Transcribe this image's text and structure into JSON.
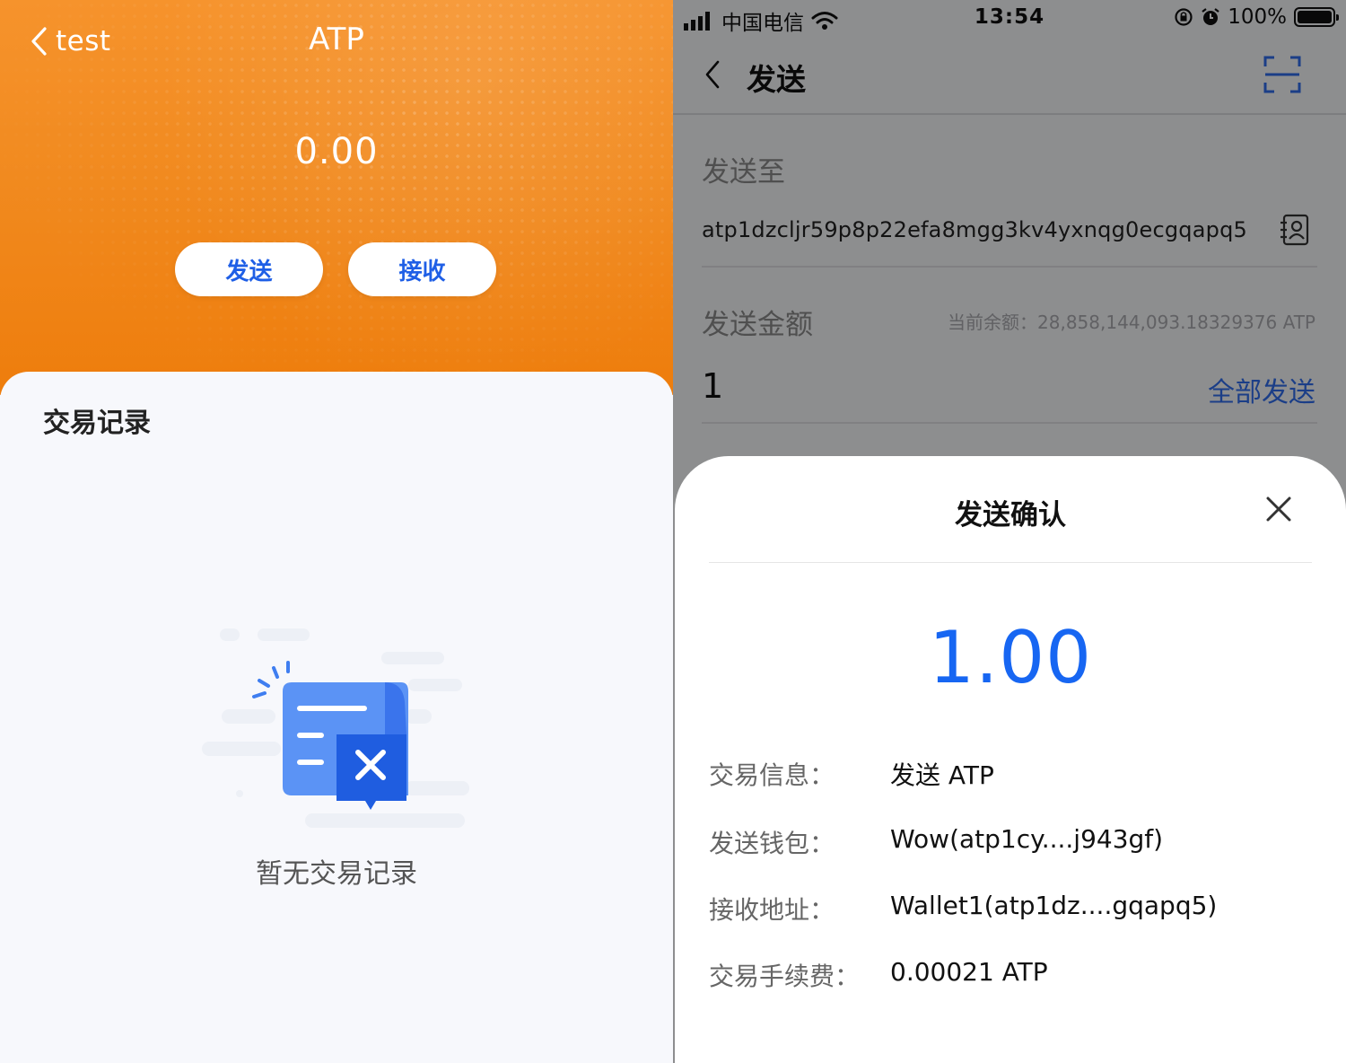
{
  "left": {
    "nav": {
      "back_label": "test",
      "title": "ATP"
    },
    "balance": "0.00",
    "actions": {
      "send": "发送",
      "receive": "接收"
    },
    "records": {
      "title": "交易记录",
      "empty_text": "暂无交易记录"
    }
  },
  "right": {
    "statusbar": {
      "carrier": "中国电信",
      "time": "13:54",
      "battery": "100%"
    },
    "nav": {
      "title": "发送"
    },
    "form": {
      "to_label": "发送至",
      "to_address": "atp1dzcljr59p8p22efa8mgg3kv4yxnqg0ecgqapq5",
      "amount_label": "发送金额",
      "balance_text": "当前余额：28,858,144,093.18329376 ATP",
      "amount_value": "1",
      "send_all": "全部发送"
    },
    "confirm": {
      "title": "发送确认",
      "amount": "1.00",
      "rows": [
        {
          "label": "交易信息：",
          "value": "发送 ATP"
        },
        {
          "label": "发送钱包：",
          "value": "Wow(atp1cy....j943gf)"
        },
        {
          "label": "接收地址：",
          "value": "Wallet1(atp1dz....gqapq5)"
        },
        {
          "label": "交易手续费：",
          "value": "0.00021 ATP"
        }
      ]
    }
  },
  "colors": {
    "orange": "#f18a1f",
    "blue_accent": "#1766f2",
    "link_blue": "#2f6be8"
  },
  "icons": [
    "back-chevron-icon",
    "scan-icon",
    "address-book-icon",
    "close-icon",
    "empty-records-icon",
    "signal-icon",
    "wifi-icon",
    "lock-rotation-icon",
    "alarm-icon",
    "battery-icon"
  ]
}
